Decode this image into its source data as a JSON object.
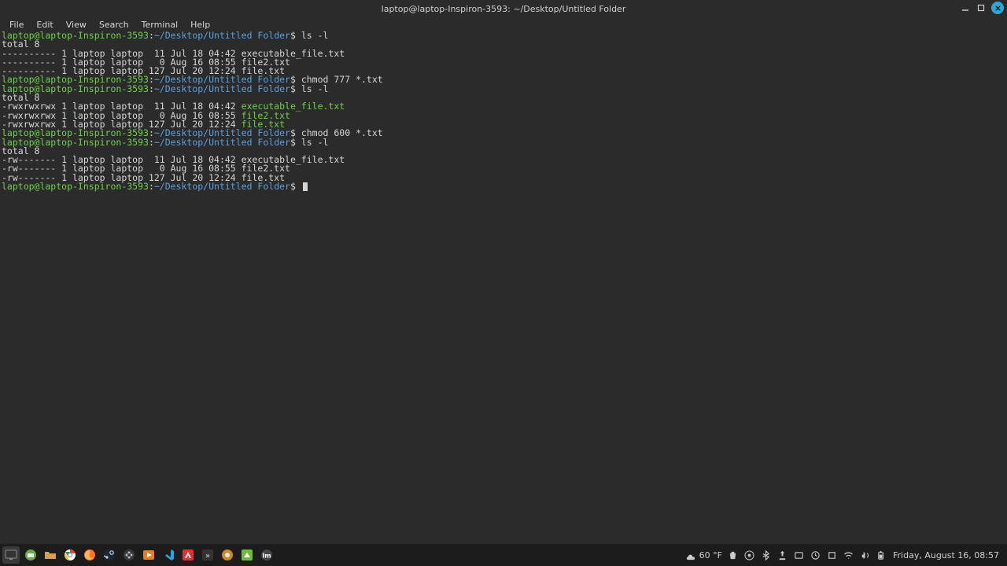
{
  "titlebar": {
    "title": "laptop@laptop-Inspiron-3593: ~/Desktop/Untitled Folder"
  },
  "menubar": {
    "items": [
      "File",
      "Edit",
      "View",
      "Search",
      "Terminal",
      "Help"
    ]
  },
  "prompt": {
    "user": "laptop@laptop-Inspiron-3593",
    "sep": ":",
    "path": "~/Desktop/Untitled Folder",
    "dollar": "$"
  },
  "session": [
    {
      "type": "cmd",
      "text": "ls -l"
    },
    {
      "type": "out",
      "text": "total 8"
    },
    {
      "type": "out",
      "text": "---------- 1 laptop laptop  11 Jul 18 04:42 executable_file.txt"
    },
    {
      "type": "out",
      "text": "---------- 1 laptop laptop   0 Aug 16 08:55 file2.txt"
    },
    {
      "type": "out",
      "text": "---------- 1 laptop laptop 127 Jul 20 12:24 file.txt"
    },
    {
      "type": "cmd",
      "text": "chmod 777 *.txt"
    },
    {
      "type": "cmd",
      "text": "ls -l"
    },
    {
      "type": "out",
      "text": "total 8"
    },
    {
      "type": "out-exec",
      "prefix": "-rwxrwxrwx 1 laptop laptop  11 Jul 18 04:42 ",
      "name": "executable_file.txt"
    },
    {
      "type": "out-exec",
      "prefix": "-rwxrwxrwx 1 laptop laptop   0 Aug 16 08:55 ",
      "name": "file2.txt"
    },
    {
      "type": "out-exec",
      "prefix": "-rwxrwxrwx 1 laptop laptop 127 Jul 20 12:24 ",
      "name": "file.txt"
    },
    {
      "type": "cmd",
      "text": "chmod 600 *.txt"
    },
    {
      "type": "cmd",
      "text": "ls -l"
    },
    {
      "type": "out",
      "text": "total 8"
    },
    {
      "type": "out",
      "text": "-rw------- 1 laptop laptop  11 Jul 18 04:42 executable_file.txt"
    },
    {
      "type": "out",
      "text": "-rw------- 1 laptop laptop   0 Aug 16 08:55 file2.txt"
    },
    {
      "type": "out",
      "text": "-rw------- 1 laptop laptop 127 Jul 20 12:24 file.txt"
    },
    {
      "type": "cmd",
      "text": "",
      "cursor": true
    }
  ],
  "taskbar": {
    "weather": "60 °F",
    "clock": "Friday, August 16, 08:57"
  }
}
